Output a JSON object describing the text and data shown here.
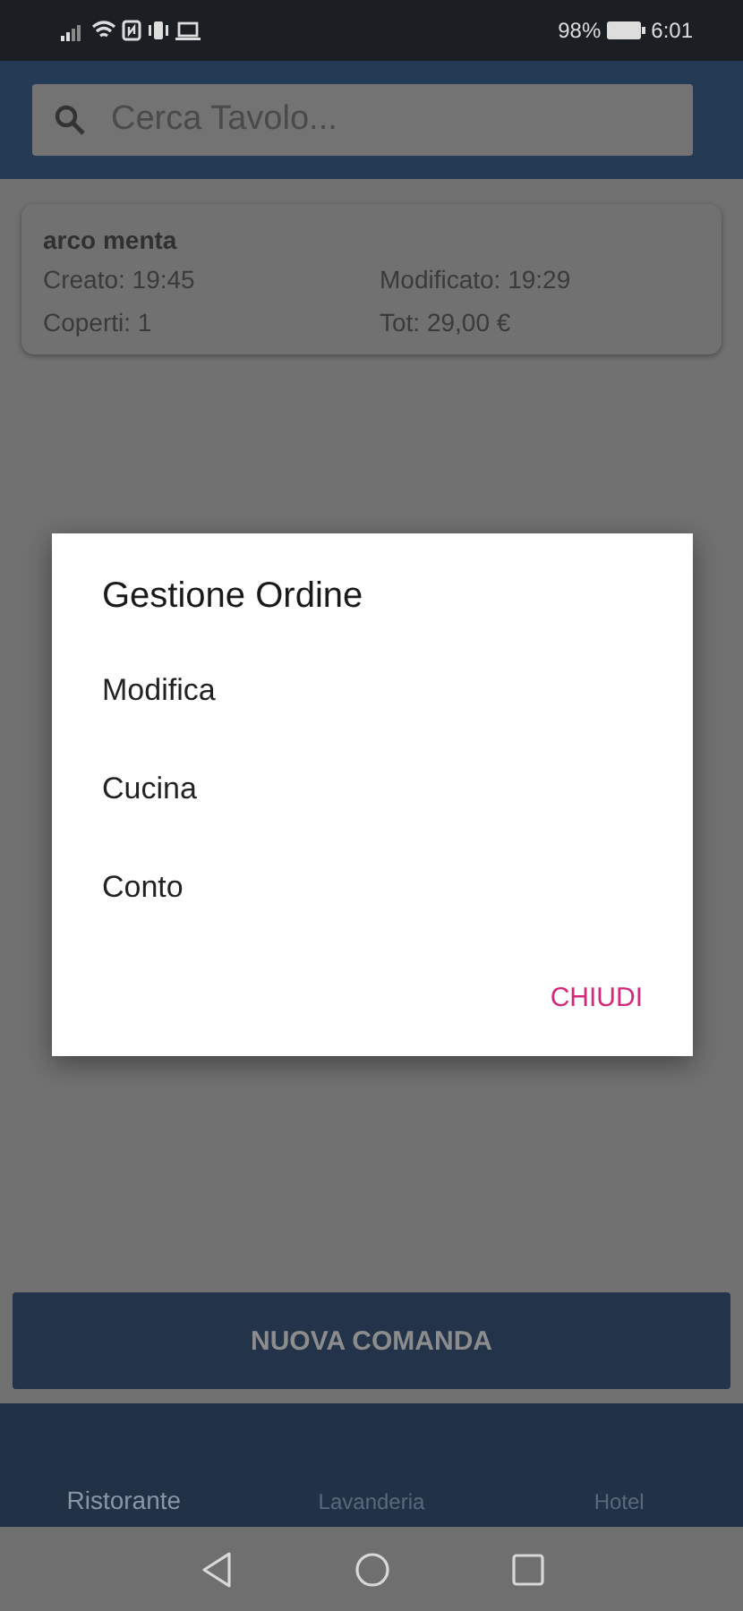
{
  "status_bar": {
    "battery": "98%",
    "time": "6:01"
  },
  "search": {
    "placeholder": "Cerca Tavolo..."
  },
  "orders": [
    {
      "name": "arco menta",
      "created": "Creato: 19:45",
      "modified": "Modificato: 19:29",
      "covers": "Coperti: 1",
      "total": "Tot: 29,00 €"
    }
  ],
  "dialog": {
    "title": "Gestione Ordine",
    "options": [
      "Modifica",
      "Cucina",
      "Conto"
    ],
    "close": "CHIUDI"
  },
  "primary_button": "NUOVA COMANDA",
  "tabs": [
    {
      "label": "Ristorante",
      "selected": true
    },
    {
      "label": "Lavanderia",
      "selected": false
    },
    {
      "label": "Hotel",
      "selected": false
    }
  ]
}
